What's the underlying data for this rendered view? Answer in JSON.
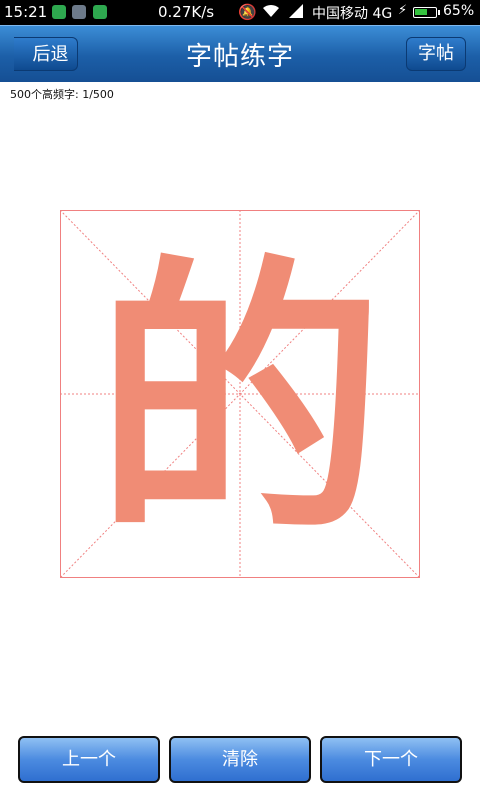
{
  "statusbar": {
    "time": "15:21",
    "speed": "0.27K/s",
    "carrier": "中国移动 4G",
    "battery_pct": "65%",
    "battery_level": 0.65
  },
  "navbar": {
    "back_label": "后退",
    "title": "字帖练字",
    "right_label": "字帖"
  },
  "counter": "500个高频字: 1/500",
  "character": {
    "glyph": "的",
    "color": "#f08c75"
  },
  "buttons": {
    "prev": "上一个",
    "clear": "清除",
    "next": "下一个"
  },
  "colors": {
    "grid_line": "#f08080",
    "nav_blue": "#1c5fa8"
  }
}
